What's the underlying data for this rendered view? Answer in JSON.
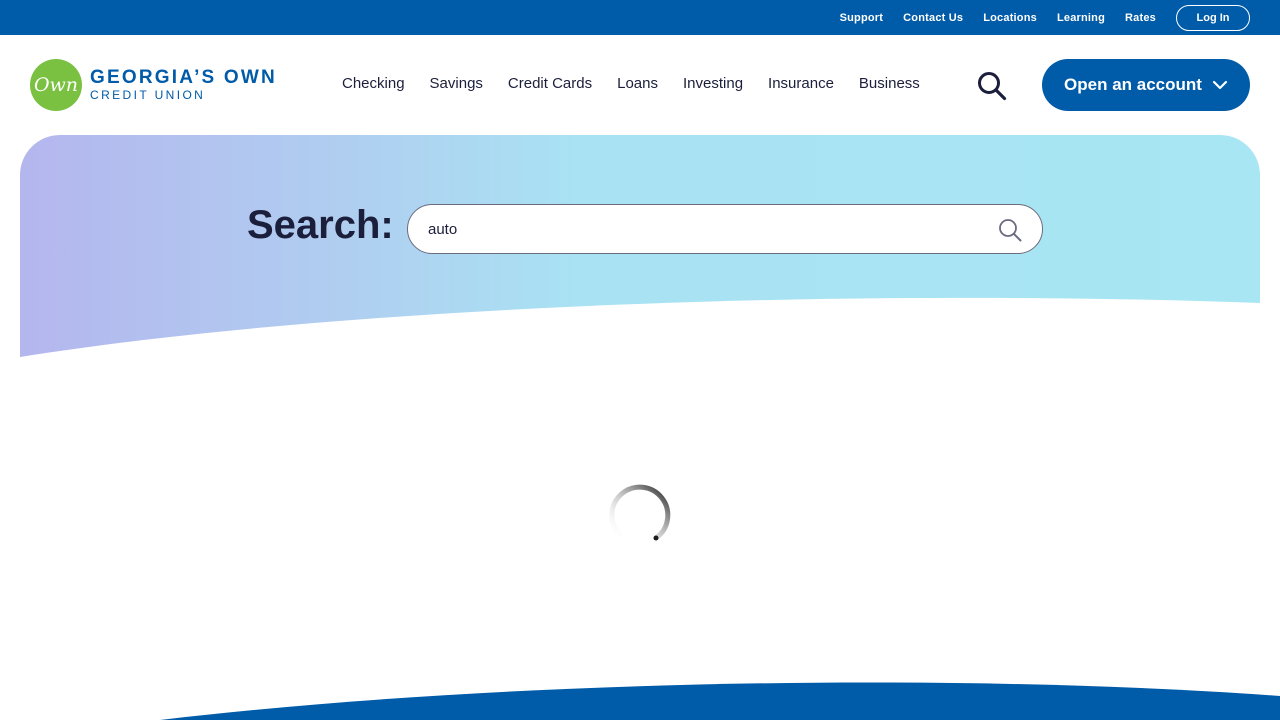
{
  "utility_nav": {
    "links": [
      "Support",
      "Contact Us",
      "Locations",
      "Learning",
      "Rates"
    ],
    "login_label": "Log In"
  },
  "logo": {
    "mark_text": "Own",
    "line1": "GEORGIA’S OWN",
    "line2": "CREDIT UNION"
  },
  "main_nav": {
    "items": [
      "Checking",
      "Savings",
      "Credit Cards",
      "Loans",
      "Investing",
      "Insurance",
      "Business"
    ],
    "search_icon": "search-icon",
    "open_account_label": "Open an account",
    "open_account_icon": "chevron-down-icon"
  },
  "search": {
    "label": "Search:",
    "value": "auto",
    "submit_icon": "search-icon"
  },
  "status": {
    "loading_icon": "loading-spinner-icon"
  },
  "colors": {
    "brand_blue": "#005ba8",
    "brand_green": "#7ac142",
    "text_dark": "#1b1f3b",
    "hero_gradient_start": "#b4b6ee",
    "hero_gradient_end": "#a8e6f3"
  }
}
